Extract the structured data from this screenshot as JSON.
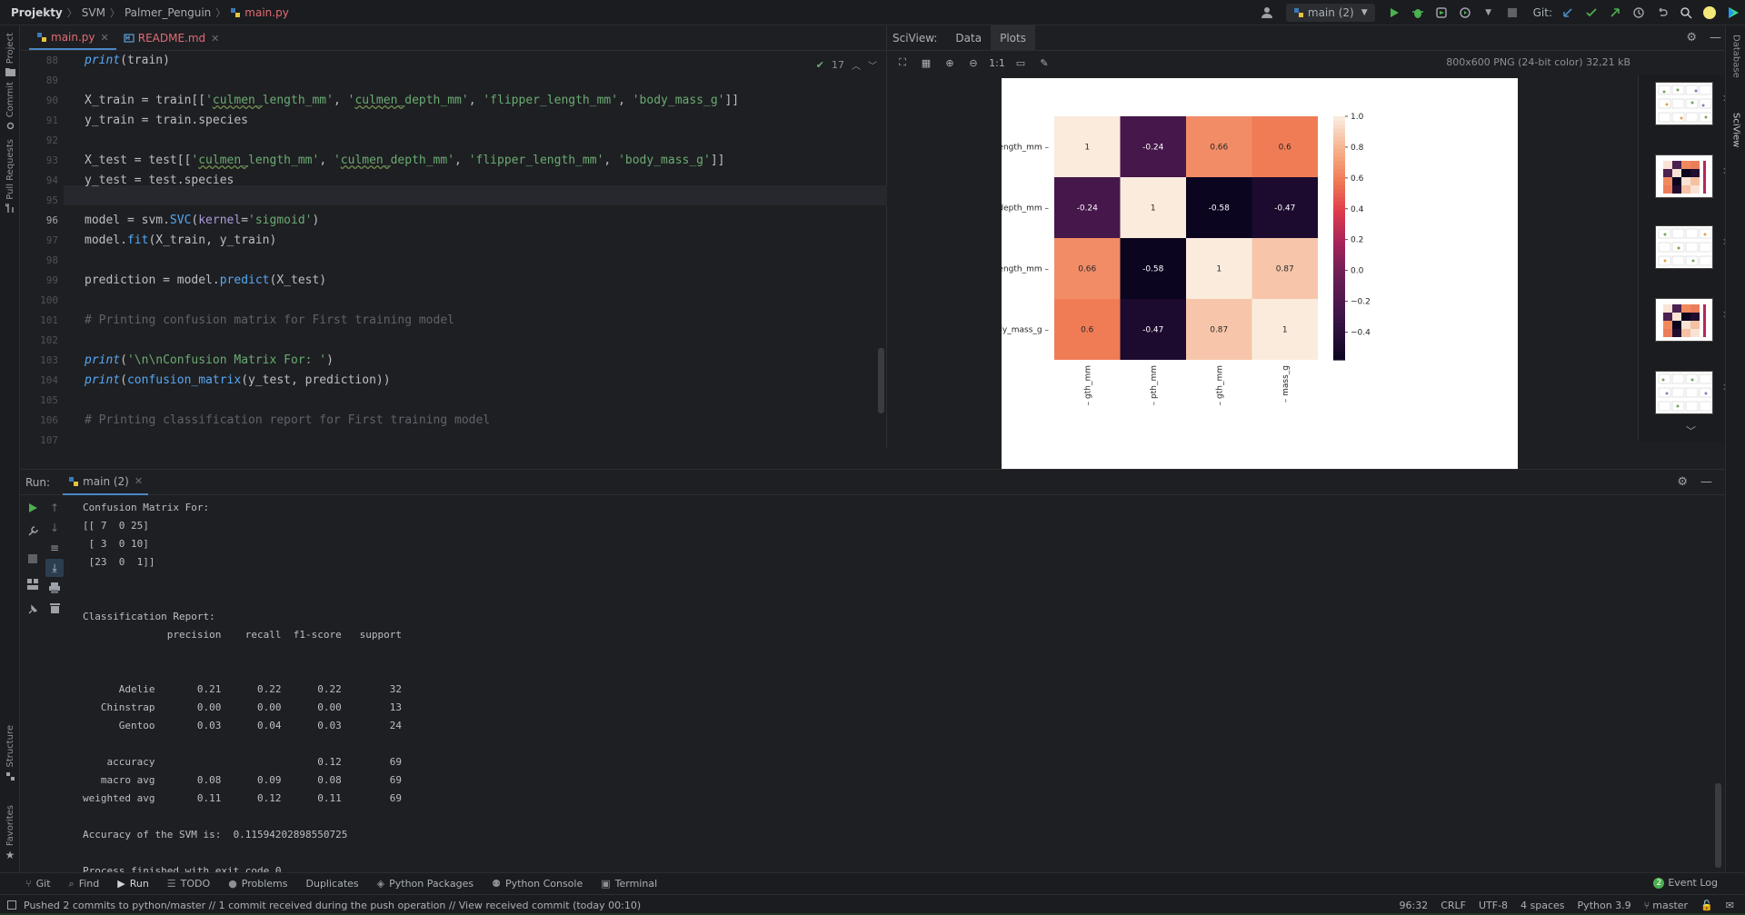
{
  "breadcrumbs": [
    "Projekty",
    "SVM",
    "Palmer_Penguin",
    "main.py"
  ],
  "topbar": {
    "run_config": "main (2)",
    "git_label": "Git:"
  },
  "left_strip": {
    "tools": [
      "Project",
      "Commit",
      "Pull Requests",
      "Structure",
      "Favorites"
    ]
  },
  "right_strip": {
    "tools": [
      "Database",
      "SciView"
    ]
  },
  "editor": {
    "tabs": [
      {
        "label": "main.py",
        "active": true
      },
      {
        "label": "README.md",
        "active": false
      }
    ],
    "inspection_count": "17",
    "current_line": 96,
    "line_numbers": [
      "88",
      "89",
      "90",
      "91",
      "92",
      "93",
      "94",
      "95",
      "96",
      "97",
      "98",
      "99",
      "100",
      "101",
      "102",
      "103",
      "104",
      "105",
      "106",
      "107"
    ],
    "lines": [
      "print(train)",
      "",
      "X_train = train[['culmen_length_mm', 'culmen_depth_mm', 'flipper_length_mm', 'body_mass_g']]",
      "y_train = train.species",
      "",
      "X_test = test[['culmen_length_mm', 'culmen_depth_mm', 'flipper_length_mm', 'body_mass_g']]",
      "y_test = test.species",
      "",
      "model = svm.SVC(kernel='sigmoid')",
      "model.fit(X_train, y_train)",
      "",
      "prediction = model.predict(X_test)",
      "",
      "# Printing confusion matrix for First training model",
      "",
      "print('\\n\\nConfusion Matrix For: ')",
      "print(confusion_matrix(y_test, prediction))",
      "",
      "# Printing classification report for First training model",
      ""
    ]
  },
  "sciview": {
    "title": "SciView:",
    "tabs": [
      "Data",
      "Plots"
    ],
    "active_tab": "Plots",
    "zoom_label": "1:1",
    "image_info": "800x600 PNG (24-bit color) 32,21 kB",
    "thumbnail_count": 5
  },
  "chart_data": {
    "type": "heatmap",
    "row_labels": [
      "n_length_mm",
      "n_depth_mm",
      "r_length_mm",
      "body_mass_g"
    ],
    "col_labels": [
      "gth_mm",
      "pth_mm",
      "gth_mm",
      "mass_g"
    ],
    "values": [
      [
        1,
        -0.24,
        0.66,
        0.6
      ],
      [
        -0.24,
        1,
        -0.58,
        -0.47
      ],
      [
        0.66,
        -0.58,
        1,
        0.87
      ],
      [
        0.6,
        -0.47,
        0.87,
        1
      ]
    ],
    "cell_labels": [
      [
        "1",
        "-0.24",
        "0.66",
        "0.6"
      ],
      [
        "-0.24",
        "1",
        "-0.58",
        "-0.47"
      ],
      [
        "0.66",
        "-0.58",
        "1",
        "0.87"
      ],
      [
        "0.6",
        "-0.47",
        "0.87",
        "1"
      ]
    ],
    "colorbar_ticks": [
      "1.0",
      "0.8",
      "0.6",
      "0.4",
      "0.2",
      "0.0",
      "−0.2",
      "−0.4"
    ],
    "colorbar_range": [
      -0.58,
      1.0
    ],
    "colormap": "rocket",
    "grid": false
  },
  "run_panel": {
    "label": "Run:",
    "tab": "main (2)",
    "output": [
      "Confusion Matrix For:",
      "[[ 7  0 25]",
      " [ 3  0 10]",
      " [23  0  1]]",
      "",
      "",
      "Classification Report:",
      "              precision    recall  f1-score   support",
      "",
      "",
      "      Adelie       0.21      0.22      0.22        32",
      "   Chinstrap       0.00      0.00      0.00        13",
      "      Gentoo       0.03      0.04      0.03        24",
      "",
      "    accuracy                           0.12        69",
      "   macro avg       0.08      0.09      0.08        69",
      "weighted avg       0.11      0.12      0.11        69",
      "",
      "Accuracy of the SVM is:  0.11594202898550725",
      "",
      "Process finished with exit code 0"
    ]
  },
  "bottom_tools": [
    {
      "label": "Git",
      "icon": "git-icon"
    },
    {
      "label": "Find",
      "icon": "search-icon"
    },
    {
      "label": "Run",
      "icon": "run-icon",
      "active": true
    },
    {
      "label": "TODO",
      "icon": "list-icon"
    },
    {
      "label": "Problems",
      "icon": "info-icon"
    },
    {
      "label": "Duplicates",
      "icon": ""
    },
    {
      "label": "Python Packages",
      "icon": "layers-icon"
    },
    {
      "label": "Python Console",
      "icon": "python-icon"
    },
    {
      "label": "Terminal",
      "icon": "terminal-icon"
    }
  ],
  "event_log": {
    "label": "Event Log",
    "count": "2"
  },
  "status": {
    "message": "Pushed 2 commits to python/master // 1 commit received during the push operation // View received commit (today 00:10)",
    "position": "96:32",
    "line_sep": "CRLF",
    "encoding": "UTF-8",
    "indent": "4 spaces",
    "interpreter": "Python 3.9",
    "branch": "master"
  },
  "colors": {
    "accent": "#4a88c7",
    "keyword": "#cf8e6d",
    "string": "#6aab73",
    "function": "#56a8f5",
    "comment": "#5f626b",
    "run_green": "#4caf50"
  }
}
